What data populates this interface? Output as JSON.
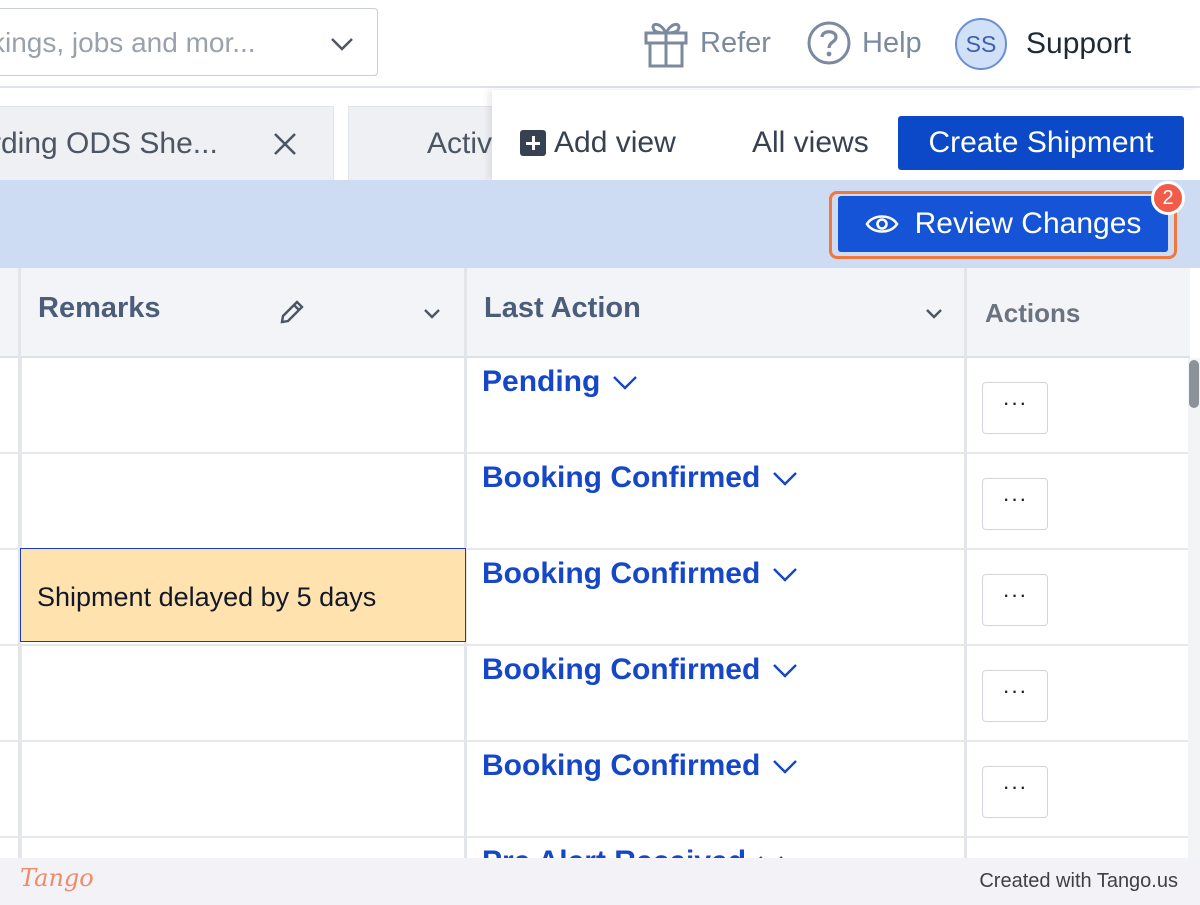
{
  "topbar": {
    "search_text": "kings, jobs and mor...",
    "refer_label": "Refer",
    "help_label": "Help",
    "avatar_initials": "SS",
    "user_name": "Support"
  },
  "tabs": {
    "active_tab_label": "rding ODS She...",
    "second_tab_label": "Activ",
    "add_view_label": "Add view",
    "all_views_label": "All views",
    "create_shipment_label": "Create Shipment"
  },
  "actionbar": {
    "review_changes_label": "Review Changes",
    "step_badge": "2"
  },
  "table": {
    "columns": [
      "Remarks",
      "Last Action",
      "Actions"
    ],
    "rows": [
      {
        "remarks": "",
        "last_action": "Pending",
        "actions": "···"
      },
      {
        "remarks": "",
        "last_action": "Booking Confirmed",
        "actions": "···"
      },
      {
        "remarks": "Shipment delayed by 5 days",
        "last_action": "Booking Confirmed",
        "actions": "···"
      },
      {
        "remarks": "",
        "last_action": "Booking Confirmed",
        "actions": "···"
      },
      {
        "remarks": "",
        "last_action": "Booking Confirmed",
        "actions": "···"
      },
      {
        "remarks": "",
        "last_action": "Pre Alert Received",
        "actions": ""
      }
    ]
  },
  "footer": {
    "logo_text": "Tango",
    "created_with": "Created with Tango.us"
  },
  "colors": {
    "primary_blue": "#0b49c8",
    "action_bar": "#cddcf3",
    "focus_orange": "#f0773e",
    "edited_cell": "#ffe2ae"
  }
}
